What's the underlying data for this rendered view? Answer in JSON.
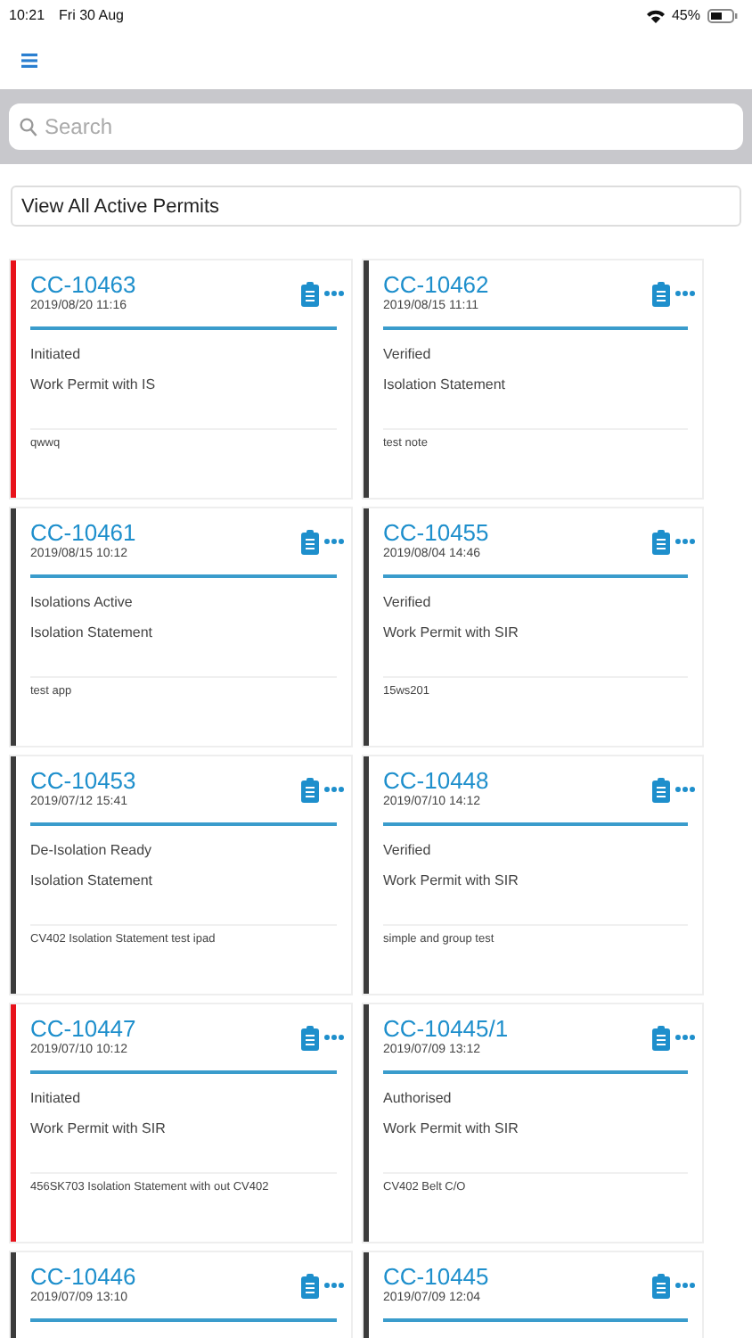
{
  "status_bar": {
    "time": "10:21",
    "date": "Fri 30 Aug",
    "battery": "45%"
  },
  "search": {
    "placeholder": "Search"
  },
  "filter": {
    "label": "View All Active Permits"
  },
  "permits": [
    {
      "id": "CC-10463",
      "date": "2019/08/20 11:16",
      "status": "Initiated",
      "type": "Work Permit with IS",
      "note": "qwwq",
      "color": "#e8121b"
    },
    {
      "id": "CC-10462",
      "date": "2019/08/15 11:11",
      "status": "Verified",
      "type": "Isolation Statement",
      "note": "test note",
      "color": "#3c3c3c"
    },
    {
      "id": "CC-10461",
      "date": "2019/08/15 10:12",
      "status": "Isolations Active",
      "type": "Isolation Statement",
      "note": "test app",
      "color": "#3c3c3c"
    },
    {
      "id": "CC-10455",
      "date": "2019/08/04 14:46",
      "status": "Verified",
      "type": "Work Permit with SIR",
      "note": "15ws201",
      "color": "#3c3c3c"
    },
    {
      "id": "CC-10453",
      "date": "2019/07/12 15:41",
      "status": "De-Isolation Ready",
      "type": "Isolation Statement",
      "note": "CV402 Isolation Statement test ipad",
      "color": "#3c3c3c"
    },
    {
      "id": "CC-10448",
      "date": "2019/07/10 14:12",
      "status": "Verified",
      "type": "Work Permit with SIR",
      "note": "simple and group test",
      "color": "#3c3c3c"
    },
    {
      "id": "CC-10447",
      "date": "2019/07/10 10:12",
      "status": "Initiated",
      "type": "Work Permit with SIR",
      "note": "456SK703 Isolation Statement with out CV402",
      "color": "#e8121b"
    },
    {
      "id": "CC-10445/1",
      "date": "2019/07/09 13:12",
      "status": "Authorised",
      "type": "Work Permit with SIR",
      "note": "CV402 Belt C/O",
      "color": "#3c3c3c"
    },
    {
      "id": "CC-10446",
      "date": "2019/07/09 13:10",
      "color": "#3c3c3c"
    },
    {
      "id": "CC-10445",
      "date": "2019/07/09 12:04",
      "color": "#3c3c3c"
    }
  ]
}
